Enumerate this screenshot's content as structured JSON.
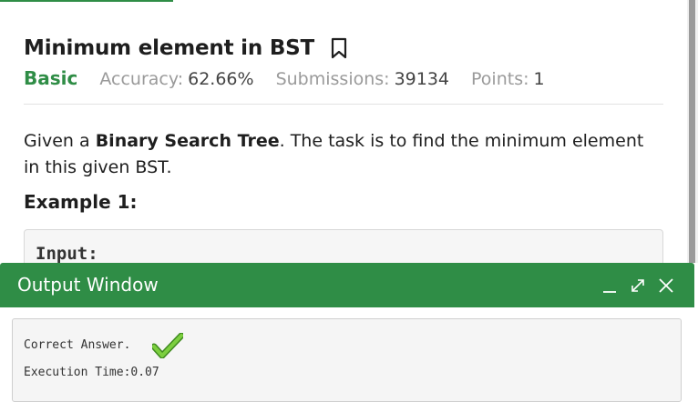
{
  "problem": {
    "title": "Minimum element in BST",
    "difficulty": "Basic",
    "accuracy_label": "Accuracy:",
    "accuracy_value": "62.66%",
    "submissions_label": "Submissions:",
    "submissions_value": "39134",
    "points_label": "Points:",
    "points_value": "1",
    "statement_prefix": "Given a ",
    "statement_bold": "Binary Search Tree",
    "statement_suffix": ". The task is to find the minimum element in this given BST.",
    "example_heading": "Example 1:",
    "example_input_label": "Input:"
  },
  "output_window": {
    "title": "Output Window",
    "result_text": "Correct Answer.",
    "execution_time": "Execution Time:0.07",
    "minimize_icon": "minimize-icon",
    "expand_icon": "expand-icon",
    "close_icon": "close-icon",
    "result_icon": "checkmark-icon"
  },
  "colors": {
    "accent": "#2f8d46",
    "check_green": "#5cb82e"
  }
}
